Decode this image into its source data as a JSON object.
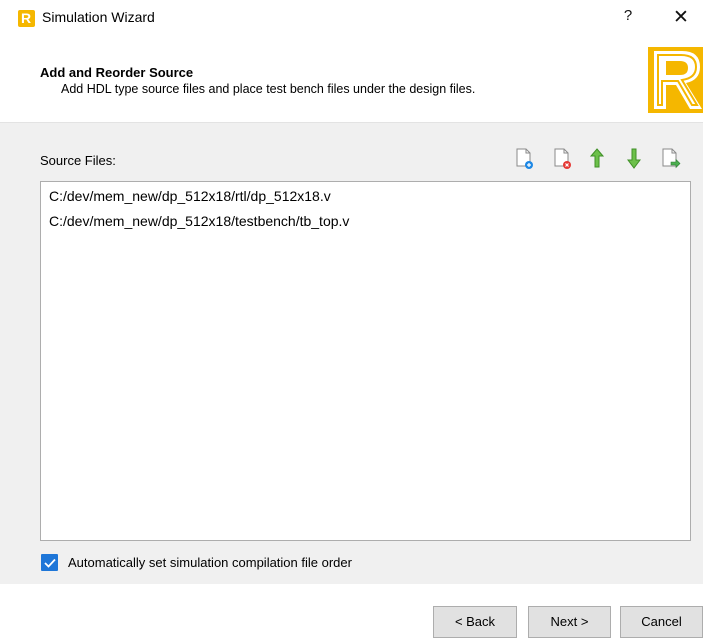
{
  "window": {
    "title": "Simulation Wizard",
    "help_symbol": "?",
    "close_symbol": "✕",
    "app_icon_letter": "R",
    "brand_color": "#f5b700"
  },
  "header": {
    "title": "Add and Reorder Source",
    "subtitle": "Add HDL type source files and place test bench files under the design files.",
    "logo_letter": "R"
  },
  "source_files": {
    "label": "Source Files:",
    "toolbar": [
      {
        "name": "add-file",
        "icon": "add-file-icon"
      },
      {
        "name": "remove-file",
        "icon": "remove-file-icon"
      },
      {
        "name": "move-up",
        "icon": "up-arrow-icon"
      },
      {
        "name": "move-down",
        "icon": "down-arrow-icon"
      },
      {
        "name": "export",
        "icon": "export-file-icon"
      }
    ],
    "files": [
      "C:/dev/mem_new/dp_512x18/rtl/dp_512x18.v",
      "C:/dev/mem_new/dp_512x18/testbench/tb_top.v"
    ]
  },
  "auto_order": {
    "checked": true,
    "label": "Automatically set simulation compilation file order"
  },
  "buttons": {
    "back": "< Back",
    "next": "Next >",
    "cancel": "Cancel"
  },
  "colors": {
    "accent": "#1e76d8",
    "up_arrow": "#4caf50",
    "remove_badge": "#e53935",
    "add_badge": "#1e88e5"
  }
}
